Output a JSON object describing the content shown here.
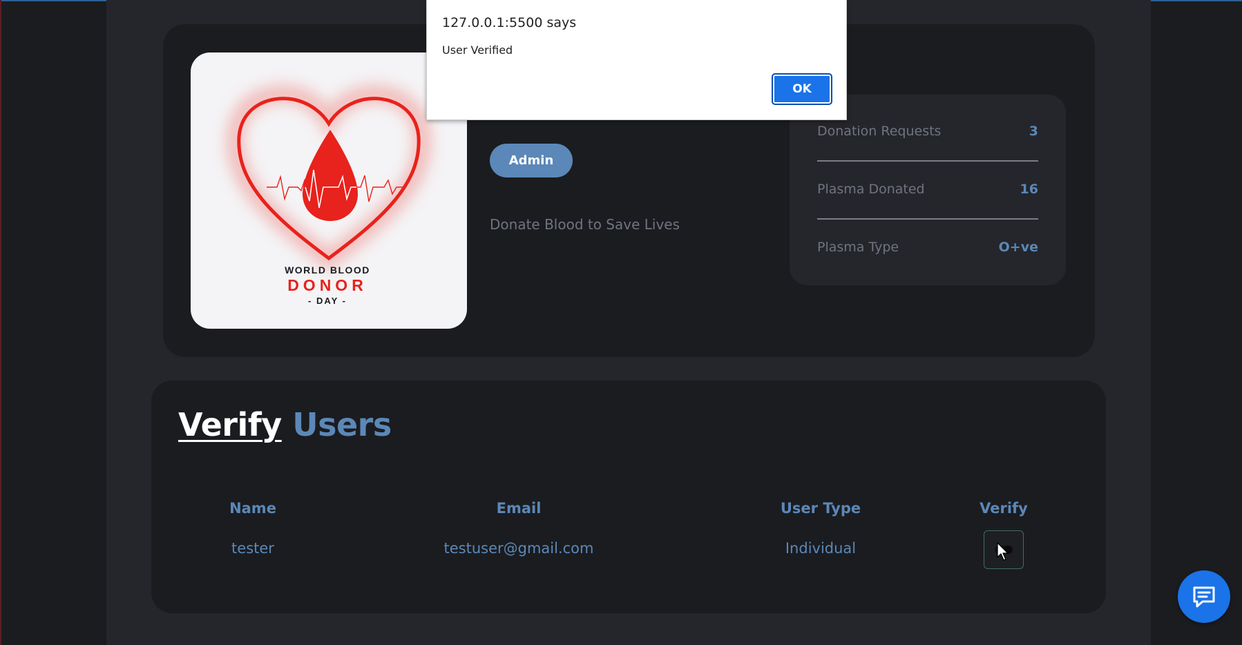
{
  "alert": {
    "origin": "127.0.0.1:5500 says",
    "message": "User Verified",
    "ok_label": "OK"
  },
  "profile": {
    "image": {
      "alt": "World Blood Donor Day",
      "line1": "WORLD BLOOD",
      "line2": "DONOR",
      "line3": "- DAY -"
    },
    "role_badge": "Admin",
    "tagline": "Donate Blood to Save Lives",
    "stats": [
      {
        "label": "Donation Requests",
        "value": "3"
      },
      {
        "label": "Plasma Donated",
        "value": "16"
      },
      {
        "label": "Plasma Type",
        "value": "O+ve"
      }
    ]
  },
  "verify_section": {
    "title_part1": "Verify",
    "title_part2": "Users",
    "columns": [
      "Name",
      "Email",
      "User Type",
      "Verify"
    ],
    "rows": [
      {
        "name": "tester",
        "email": "testuser@gmail.com",
        "user_type": "Individual"
      }
    ]
  },
  "icons": {
    "chat": "chat-icon",
    "verify": "toggle-icon",
    "cursor": "mouse-pointer-icon"
  },
  "colors": {
    "accent": "#5b88b8",
    "page_bg": "#1b1c20",
    "column_bg": "#25262b",
    "dialog_button": "#1a73e8",
    "blood_red": "#e8221c"
  }
}
